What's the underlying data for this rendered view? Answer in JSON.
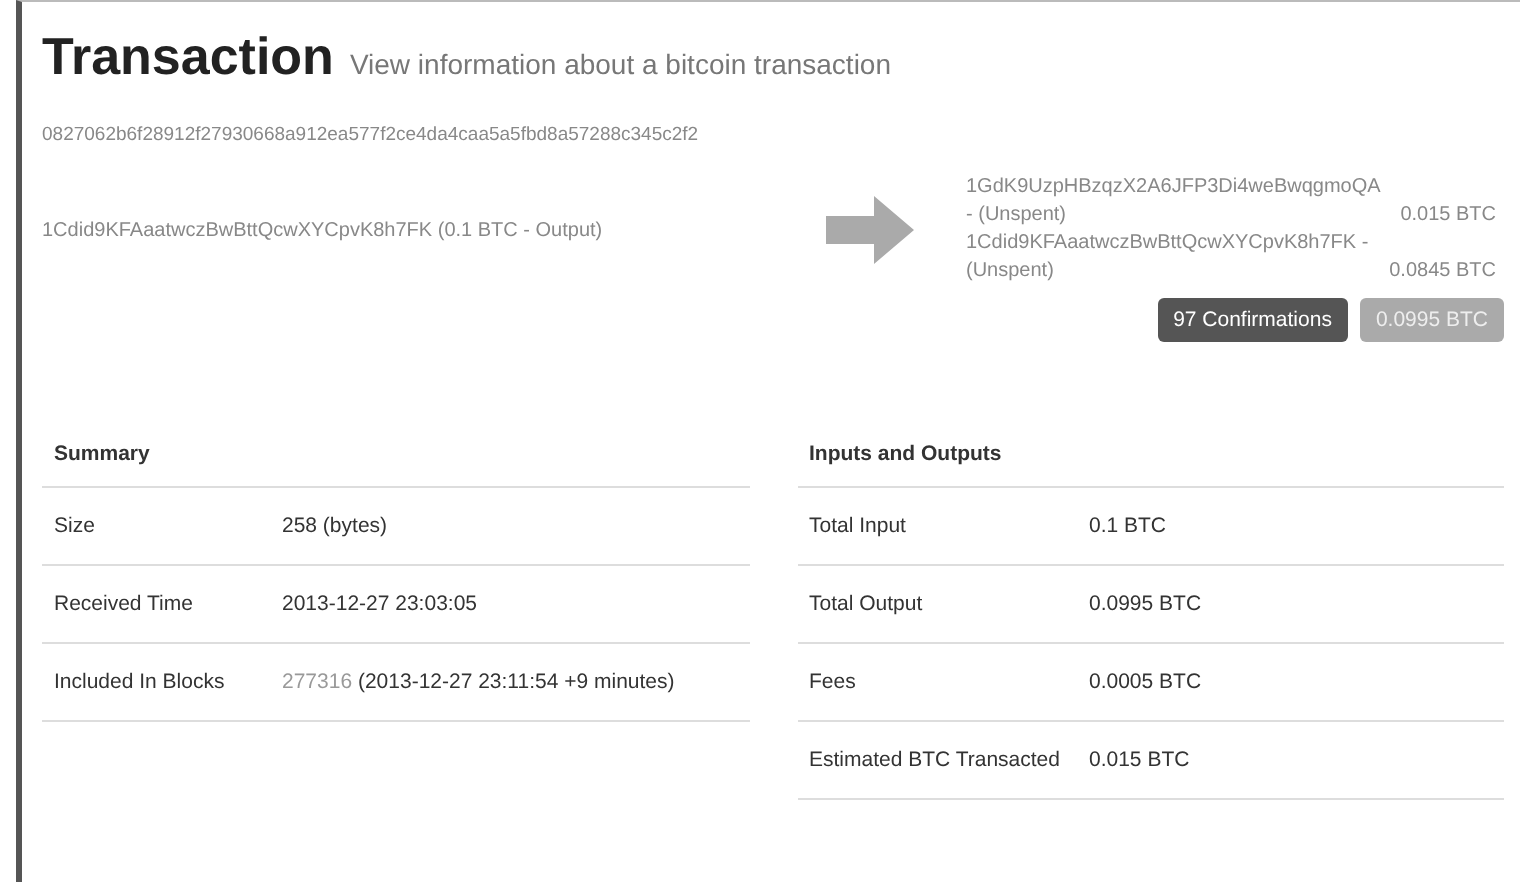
{
  "header": {
    "title": "Transaction",
    "subtitle": "View information about a bitcoin transaction"
  },
  "hash": "0827062b6f28912f27930668a912ea577f2ce4da4caa5a5fbd8a57288c345c2f2",
  "input": "1Cdid9KFAaatwczBwBttQcwXYCpvK8h7FK (0.1 BTC - Output)",
  "outputs": [
    {
      "address": "1GdK9UzpHBzqzX2A6JFP3Di4weBwqgmoQA",
      "status": "- (Unspent)",
      "amount": "0.015 BTC"
    },
    {
      "address": "1Cdid9KFAaatwczBwBttQcwXYCpvK8h7FK -",
      "status": "(Unspent)",
      "amount": "0.0845 BTC"
    }
  ],
  "badges": [
    {
      "kind": "dark",
      "label": "97 Confirmations"
    },
    {
      "kind": "light",
      "label": "0.0995 BTC"
    }
  ],
  "summary": {
    "title": "Summary",
    "rows": [
      {
        "label": "Size",
        "value": "258 (bytes)"
      },
      {
        "label": "Received Time",
        "value": "2013-12-27 23:03:05"
      },
      {
        "label": "Included In Blocks",
        "link": "277316",
        "value": " (2013-12-27 23:11:54 +9 minutes)"
      }
    ]
  },
  "totals": {
    "title": "Inputs and Outputs",
    "rows": [
      {
        "label": "Total Input",
        "value": "0.1 BTC"
      },
      {
        "label": "Total Output",
        "value": "0.0995 BTC"
      },
      {
        "label": "Fees",
        "value": "0.0005 BTC"
      },
      {
        "label": "Estimated BTC Transacted",
        "value": "0.015 BTC"
      }
    ]
  }
}
